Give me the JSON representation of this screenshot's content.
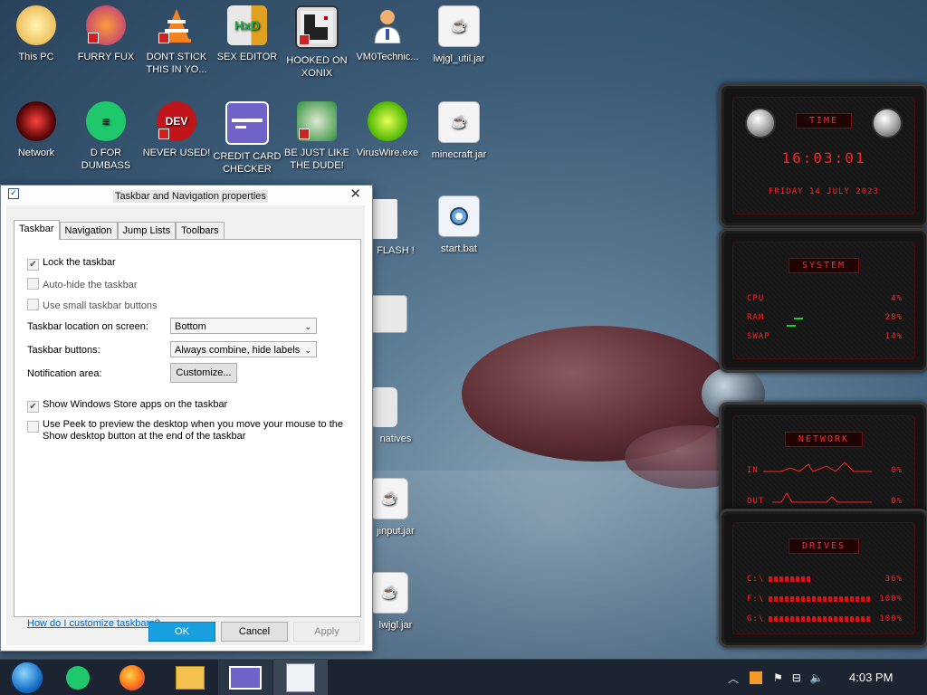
{
  "desktop_icons": [
    {
      "label": "This PC"
    },
    {
      "label": "FURRY FUX"
    },
    {
      "label": "DONT STICK THIS IN YO..."
    },
    {
      "label": "SEX EDITOR"
    },
    {
      "label": "HOOKED ON XONIX"
    },
    {
      "label": "VM0Technic..."
    },
    {
      "label": "lwjgl_util.jar"
    },
    {
      "label": "Network"
    },
    {
      "label": "D FOR DUMBASS"
    },
    {
      "label": "NEVER USED!"
    },
    {
      "label": "CREDIT CARD CHECKER"
    },
    {
      "label": "BE JUST LIKE THE DUDE!"
    },
    {
      "label": "VirusWire.exe"
    },
    {
      "label": "minecraft.jar"
    },
    {
      "label": "FLASH !"
    },
    {
      "label": "start.bat"
    },
    {
      "label": "natives"
    },
    {
      "label": "jinput.jar"
    },
    {
      "label": "lwjgl.jar"
    }
  ],
  "dialog": {
    "title": "Taskbar and Navigation properties",
    "close": "✕",
    "tabs": [
      "Taskbar",
      "Navigation",
      "Jump Lists",
      "Toolbars"
    ],
    "checkboxes": [
      {
        "label": "Lock the taskbar",
        "checked": true
      },
      {
        "label": "Auto-hide the taskbar",
        "checked": false
      },
      {
        "label": "Use small taskbar buttons",
        "checked": false
      },
      {
        "label": "Show Windows Store apps on the taskbar",
        "checked": true
      },
      {
        "label": "Use Peek to preview the desktop when you move your mouse to the",
        "label2": "Show desktop button at the end of the taskbar",
        "checked": false
      }
    ],
    "location_label": "Taskbar location on screen:",
    "location_value": "Bottom",
    "buttons_label": "Taskbar buttons:",
    "buttons_value": "Always combine, hide labels",
    "notification_label": "Notification area:",
    "customize": "Customize...",
    "help_link": "How do I customize taskbars?",
    "ok": "OK",
    "cancel": "Cancel",
    "apply": "Apply"
  },
  "gadgets": {
    "time": {
      "header": "TIME",
      "clock": "16:03:01",
      "date": "FRIDAY 14 JULY 2023"
    },
    "system": {
      "header": "SYSTEM",
      "rows": [
        {
          "label": "CPU",
          "value": "4%"
        },
        {
          "label": "RAM",
          "value": "28%"
        },
        {
          "label": "SWAP",
          "value": "14%"
        }
      ]
    },
    "network": {
      "header": "NETWORK",
      "rows": [
        {
          "label": "IN",
          "value": "0%"
        },
        {
          "label": "OUT",
          "value": "0%"
        }
      ]
    },
    "drives": {
      "header": "DRIVES",
      "rows": [
        {
          "label": "C:\\",
          "value": "36%"
        },
        {
          "label": "F:\\",
          "value": "100%"
        },
        {
          "label": "G:\\",
          "value": "100%"
        }
      ]
    }
  },
  "taskbar": {
    "clock": "4:03 PM",
    "colors": {
      "bg": "#1b2430",
      "accent": "#18a0e0"
    }
  }
}
